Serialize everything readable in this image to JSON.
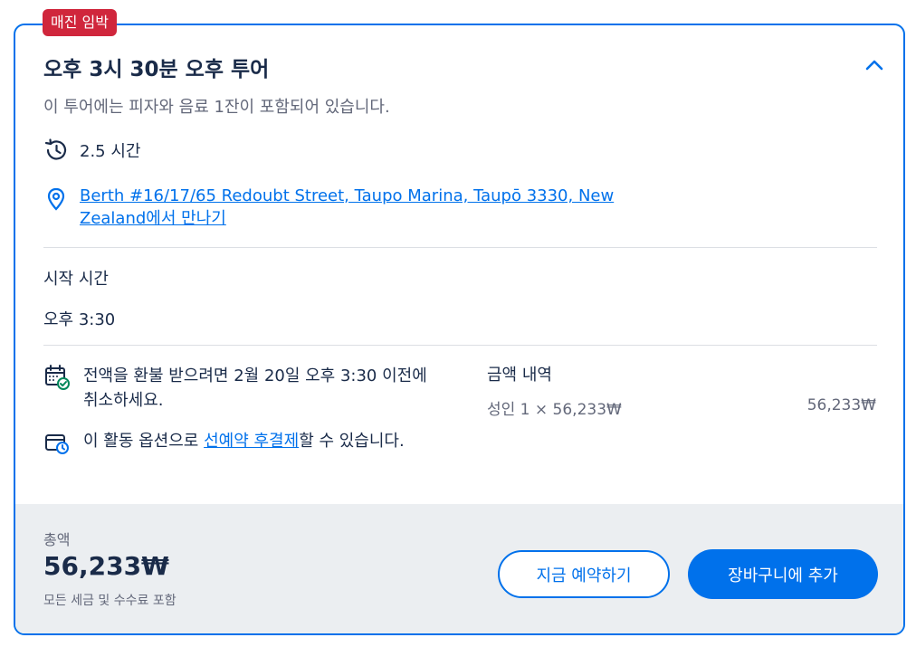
{
  "badge": "매진 임박",
  "title": "오후 3시 30분 오후 투어",
  "description": "이 투어에는 피자와 음료 1잔이 포함되어 있습니다.",
  "duration": "2.5 시간",
  "meeting_point": {
    "link_text": "Berth #16/17/65 Redoubt Street, Taupo Marina, Taupō 3330, New Zealand에서 만나기"
  },
  "start_time": {
    "label": "시작 시간",
    "value": "오후 3:30"
  },
  "refund": {
    "text": "전액을 환불 받으려면 2월 20일 오후 3:30 이전에 취소하세요."
  },
  "reserve": {
    "prefix": "이 활동 옵션으로 ",
    "link": "선예약 후결제",
    "suffix": "할 수 있습니다."
  },
  "price_breakdown": {
    "title": "금액 내역",
    "line_label": "성인 1 × 56,233₩",
    "line_value": "56,233₩"
  },
  "footer": {
    "total_label": "총액",
    "total_value": "56,233₩",
    "total_note": "모든 세금 및 수수료 포함",
    "book_now": "지금 예약하기",
    "add_to_cart": "장바구니에 추가"
  },
  "colors": {
    "accent": "#0071eb",
    "badge": "#d0263c",
    "footer_bg": "#ebeef1"
  }
}
